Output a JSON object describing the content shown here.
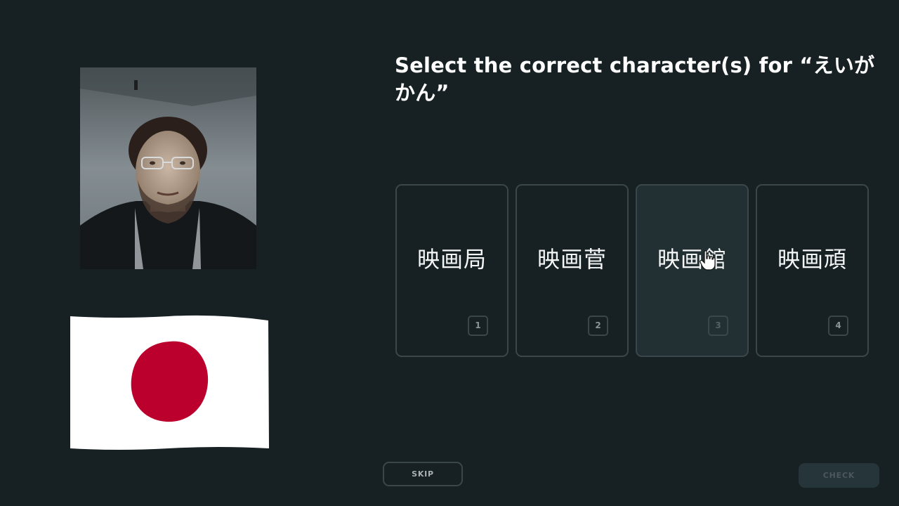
{
  "question": {
    "line1": "Select the correct character(s) for “えいが",
    "line2": "かん”"
  },
  "options": [
    {
      "text": "映画局",
      "key": "1"
    },
    {
      "text": "映画菅",
      "key": "2"
    },
    {
      "text": "映画館",
      "key": "3"
    },
    {
      "text": "映画頑",
      "key": "4"
    }
  ],
  "hovered_option": 3,
  "buttons": {
    "skip": "SKIP",
    "check": "CHECK"
  },
  "colors": {
    "background": "#172124",
    "card_border": "#3a474a",
    "card_hover": "#233033",
    "flag_red": "#bc002d",
    "check_disabled": "#26353a"
  },
  "icons": {
    "flag": "japan-flag",
    "cursor": "hand-pointer-icon"
  }
}
